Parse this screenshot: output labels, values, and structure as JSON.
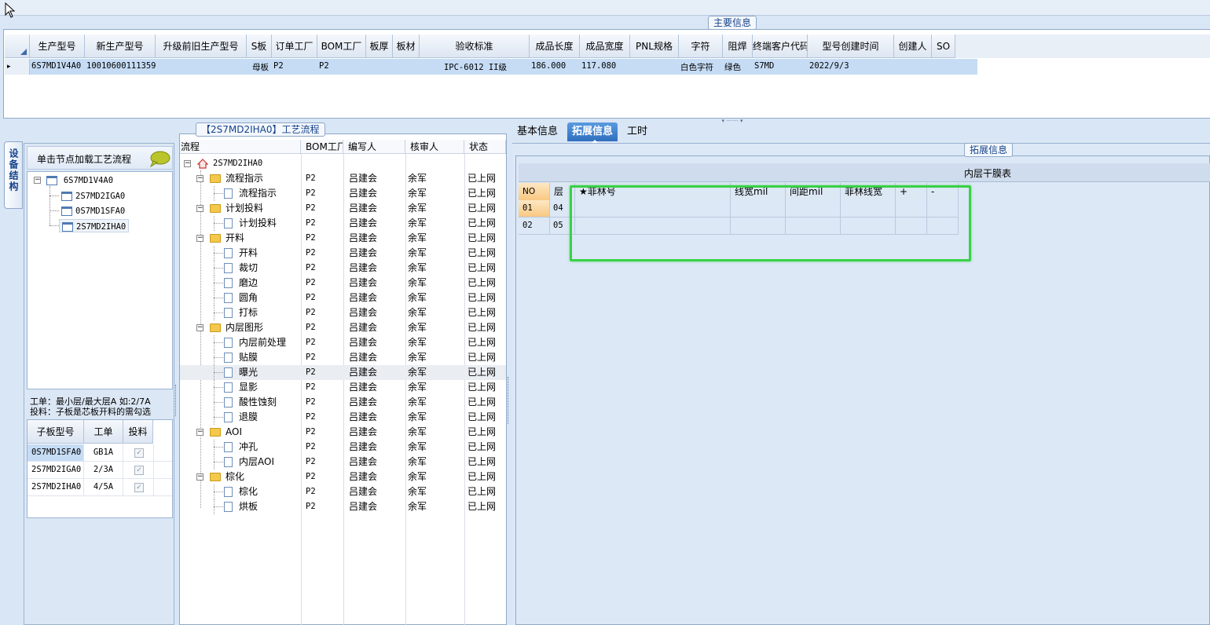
{
  "main_group": {
    "title": "主要信息"
  },
  "main_table": {
    "columns": [
      "生产型号",
      "新生产型号",
      "升级前旧生产型号",
      "S板",
      "订单工厂",
      "BOM工厂",
      "板厚",
      "板材",
      "验收标准",
      "成品长度",
      "成品宽度",
      "PNL规格",
      "字符",
      "阻焊",
      "终端客户代码",
      "型号创建时间",
      "创建人",
      "SO"
    ],
    "row": [
      "6S7MD1V4A0",
      "10010600111359",
      "",
      "母板",
      "P2",
      "P2",
      "",
      "",
      "IPC-6012 II级",
      "186.000",
      "117.080",
      "",
      "白色字符",
      "绿色",
      "S7MD",
      "2022/9/3",
      "",
      ""
    ]
  },
  "left_panel": {
    "vertical_tab": "设备结构",
    "hint": "单击节点加载工艺流程",
    "tree": {
      "root": "6S7MD1V4A0",
      "children": [
        "2S7MD2IGA0",
        "0S7MD1SFA0",
        "2S7MD2IHA0"
      ]
    },
    "note1": "工单：最小层/最大层A 如:2/7A",
    "note2": "投料：子板是芯板开料的需勾选",
    "sub_table": {
      "headers": [
        "子板型号",
        "工单",
        "投料"
      ],
      "rows": [
        [
          "0S7MD1SFA0",
          "GB1A"
        ],
        [
          "2S7MD2IGA0",
          "2/3A"
        ],
        [
          "2S7MD2IHA0",
          "4/5A"
        ]
      ]
    }
  },
  "flow_group": {
    "title": "【2S7MD2IHA0】工艺流程",
    "headers": [
      "流程",
      "BOM工厂",
      "编写人",
      "核审人",
      "状态"
    ],
    "root": "2S7MD2IHA0",
    "rows": [
      {
        "level": 1,
        "type": "folder",
        "name": "流程指示",
        "bom": "P2",
        "writer": "吕建会",
        "reviewer": "余军",
        "status": "已上网"
      },
      {
        "level": 2,
        "type": "doc",
        "name": "流程指示",
        "bom": "P2",
        "writer": "吕建会",
        "reviewer": "余军",
        "status": "已上网"
      },
      {
        "level": 1,
        "type": "folder",
        "name": "计划投料",
        "bom": "P2",
        "writer": "吕建会",
        "reviewer": "余军",
        "status": "已上网"
      },
      {
        "level": 2,
        "type": "doc",
        "name": "计划投料",
        "bom": "P2",
        "writer": "吕建会",
        "reviewer": "余军",
        "status": "已上网"
      },
      {
        "level": 1,
        "type": "folder",
        "name": "开料",
        "bom": "P2",
        "writer": "吕建会",
        "reviewer": "余军",
        "status": "已上网"
      },
      {
        "level": 2,
        "type": "doc",
        "name": "开料",
        "bom": "P2",
        "writer": "吕建会",
        "reviewer": "余军",
        "status": "已上网"
      },
      {
        "level": 2,
        "type": "doc",
        "name": "裁切",
        "bom": "P2",
        "writer": "吕建会",
        "reviewer": "余军",
        "status": "已上网"
      },
      {
        "level": 2,
        "type": "doc",
        "name": "磨边",
        "bom": "P2",
        "writer": "吕建会",
        "reviewer": "余军",
        "status": "已上网"
      },
      {
        "level": 2,
        "type": "doc",
        "name": "圆角",
        "bom": "P2",
        "writer": "吕建会",
        "reviewer": "余军",
        "status": "已上网"
      },
      {
        "level": 2,
        "type": "doc",
        "name": "打标",
        "bom": "P2",
        "writer": "吕建会",
        "reviewer": "余军",
        "status": "已上网"
      },
      {
        "level": 1,
        "type": "folder",
        "name": "内层图形",
        "bom": "P2",
        "writer": "吕建会",
        "reviewer": "余军",
        "status": "已上网"
      },
      {
        "level": 2,
        "type": "doc",
        "name": "内层前处理",
        "bom": "P2",
        "writer": "吕建会",
        "reviewer": "余军",
        "status": "已上网"
      },
      {
        "level": 2,
        "type": "doc",
        "name": "贴膜",
        "bom": "P2",
        "writer": "吕建会",
        "reviewer": "余军",
        "status": "已上网"
      },
      {
        "level": 2,
        "type": "doc",
        "name": "曝光",
        "bom": "P2",
        "writer": "吕建会",
        "reviewer": "余军",
        "status": "已上网",
        "selected": true
      },
      {
        "level": 2,
        "type": "doc",
        "name": "显影",
        "bom": "P2",
        "writer": "吕建会",
        "reviewer": "余军",
        "status": "已上网"
      },
      {
        "level": 2,
        "type": "doc",
        "name": "酸性蚀刻",
        "bom": "P2",
        "writer": "吕建会",
        "reviewer": "余军",
        "status": "已上网"
      },
      {
        "level": 2,
        "type": "doc",
        "name": "退膜",
        "bom": "P2",
        "writer": "吕建会",
        "reviewer": "余军",
        "status": "已上网"
      },
      {
        "level": 1,
        "type": "folder",
        "name": "AOI",
        "bom": "P2",
        "writer": "吕建会",
        "reviewer": "余军",
        "status": "已上网"
      },
      {
        "level": 2,
        "type": "doc",
        "name": "冲孔",
        "bom": "P2",
        "writer": "吕建会",
        "reviewer": "余军",
        "status": "已上网"
      },
      {
        "level": 2,
        "type": "doc",
        "name": "内层AOI",
        "bom": "P2",
        "writer": "吕建会",
        "reviewer": "余军",
        "status": "已上网"
      },
      {
        "level": 1,
        "type": "folder",
        "name": "棕化",
        "bom": "P2",
        "writer": "吕建会",
        "reviewer": "余军",
        "status": "已上网"
      },
      {
        "level": 2,
        "type": "doc",
        "name": "棕化",
        "bom": "P2",
        "writer": "吕建会",
        "reviewer": "余军",
        "status": "已上网"
      },
      {
        "level": 2,
        "type": "doc",
        "name": "烘板",
        "bom": "P2",
        "writer": "吕建会",
        "reviewer": "余军",
        "status": "已上网"
      }
    ]
  },
  "right_panel": {
    "tabs": [
      "基本信息",
      "拓展信息",
      "工时"
    ],
    "active_tab": 1,
    "group_title": "拓展信息",
    "table_title": "内层干膜表",
    "columns": [
      "NO",
      "层",
      "★菲林号",
      "线宽mil",
      "间距mil",
      "菲林线宽",
      "+",
      "-"
    ],
    "rows": [
      [
        "01",
        "04"
      ],
      [
        "02",
        "05"
      ]
    ]
  },
  "colors": {
    "accent": "#3d7fc9",
    "selection": "#c6dcf5",
    "highlight_box": "#3ad048"
  }
}
